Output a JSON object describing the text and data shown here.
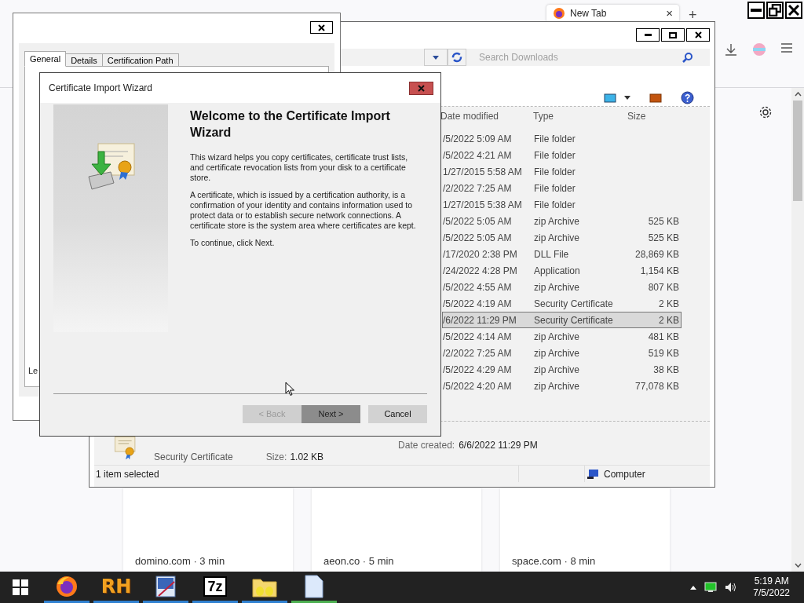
{
  "browser": {
    "tab": {
      "title": "New Tab",
      "close": "×"
    },
    "new_tab": "+",
    "cards": [
      {
        "caption": "domino.com · 3 min"
      },
      {
        "caption": "aeon.co · 5 min"
      },
      {
        "caption": "space.com · 8 min"
      }
    ]
  },
  "explorer": {
    "search": {
      "placeholder": "Search Downloads"
    },
    "columns": [
      "Date modified",
      "Type",
      "Size"
    ],
    "rows": [
      {
        "date": "/5/2022 5:09 AM",
        "type": "File folder",
        "selected": false
      },
      {
        "date": "/5/2022 4:21 AM",
        "type": "File folder",
        "selected": false
      },
      {
        "date": "1/27/2015 5:58 AM",
        "type": "File folder",
        "selected": false
      },
      {
        "date": "/2/2022 7:25 AM",
        "type": "File folder",
        "selected": false
      },
      {
        "date": "1/27/2015 5:38 AM",
        "type": "File folder",
        "selected": false
      },
      {
        "date": "/5/2022 5:05 AM",
        "type": "zip Archive",
        "size": "525 KB",
        "selected": false
      },
      {
        "date": "/5/2022 5:05 AM",
        "type": "zip Archive",
        "size": "525 KB",
        "selected": false
      },
      {
        "date": "/17/2020 2:38 PM",
        "type": "DLL File",
        "size": "28,869 KB",
        "selected": false
      },
      {
        "date": "/24/2022 4:28 PM",
        "type": "Application",
        "size": "1,154 KB",
        "selected": false
      },
      {
        "date": "/5/2022 4:55 AM",
        "type": "zip Archive",
        "size": "807 KB",
        "selected": false
      },
      {
        "date": "/5/2022 4:19 AM",
        "type": "Security Certificate",
        "size": "2 KB",
        "selected": false
      },
      {
        "date": "/6/2022 11:29 PM",
        "type": "Security Certificate",
        "size": "2 KB",
        "selected": true
      },
      {
        "date": "/5/2022 4:14 AM",
        "type": "zip Archive",
        "size": "481 KB",
        "selected": false
      },
      {
        "date": "/2/2022 7:25 AM",
        "type": "zip Archive",
        "size": "519 KB",
        "selected": false
      },
      {
        "date": "/5/2022 4:29 AM",
        "type": "zip Archive",
        "size": "38 KB",
        "selected": false
      },
      {
        "date": "/5/2022 4:20 AM",
        "type": "zip Archive",
        "size": "77,078 KB",
        "selected": false
      }
    ],
    "details": {
      "type": "Security Certificate",
      "size_label": "Size:",
      "size": "1.02 KB",
      "created_label": "Date created:",
      "created": "6/6/2022 11:29 PM"
    },
    "status": "1 item selected",
    "location": "Computer"
  },
  "cert_dialog": {
    "tabs": [
      {
        "label": "General",
        "selected": true
      },
      {
        "label": "Details",
        "selected": false
      },
      {
        "label": "Certification Path",
        "selected": false
      }
    ],
    "partial_label": "Le"
  },
  "wizard": {
    "title": "Certificate Import Wizard",
    "heading": "Welcome to the Certificate Import Wizard",
    "paragraphs": [
      "This wizard helps you copy certificates, certificate trust lists, and certificate revocation lists from your disk to a certificate store.",
      "A certificate, which is issued by a certification authority, is a confirmation of your identity and contains information used to protect data or to establish secure network connections. A certificate store is the system area where certificates are kept.",
      "To continue, click Next."
    ],
    "buttons": [
      {
        "label": "< Back",
        "disabled": true,
        "hovered": false
      },
      {
        "label": "Next >",
        "disabled": false,
        "hovered": true
      },
      {
        "label": "Cancel",
        "disabled": false,
        "hovered": false
      }
    ]
  },
  "taskbar": {
    "apps": [
      {
        "kind": "firefox",
        "selected": false
      },
      {
        "kind": "logo",
        "label": "RH",
        "selected": false
      },
      {
        "kind": "paint",
        "selected": false
      },
      {
        "kind": "boxed",
        "label": "7z",
        "selected": false
      },
      {
        "kind": "folder",
        "selected": false
      },
      {
        "kind": "document",
        "selected": true
      }
    ],
    "time": "5:19 AM",
    "date": "7/5/2022"
  }
}
